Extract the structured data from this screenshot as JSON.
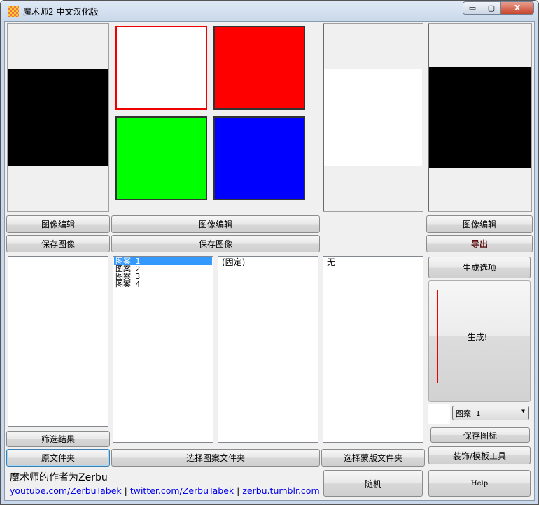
{
  "window": {
    "title": "魔术师2 中文汉化版",
    "minimize": "▭",
    "maximize": "▢",
    "close": "X"
  },
  "buttons": {
    "image_edit_1": "图像编辑",
    "image_edit_2": "图像编辑",
    "image_edit_3": "图像编辑",
    "save_image_1": "保存图像",
    "save_image_2": "保存图像",
    "export": "导出",
    "gen_options": "生成选项",
    "generate": "生成!",
    "save_icon": "保存图标",
    "decor_tools": "装饰/模板工具",
    "help": "Help",
    "filter_results": "筛选结果",
    "source_folder": "原文件夹",
    "select_pattern_folder": "选择图案文件夹",
    "select_mask_folder": "选择蒙版文件夹",
    "random": "随机"
  },
  "patterns": [
    "图案 1",
    "图案 2",
    "图案 3",
    "图案 4"
  ],
  "fixed_list": [
    "(固定)"
  ],
  "mask_list": [
    "无"
  ],
  "combo": {
    "value": "图案 1"
  },
  "footer": {
    "author": "魔术师的作者为Zerbu",
    "links": [
      "youtube.com/ZerbuTabek",
      "twitter.com/ZerbuTabek",
      "zerbu.tumblr.com"
    ],
    "sep": "|"
  },
  "colors": {
    "red": "#ff0000",
    "green": "#00ff00",
    "blue": "#0000ff",
    "export_text": "#5a1010"
  }
}
